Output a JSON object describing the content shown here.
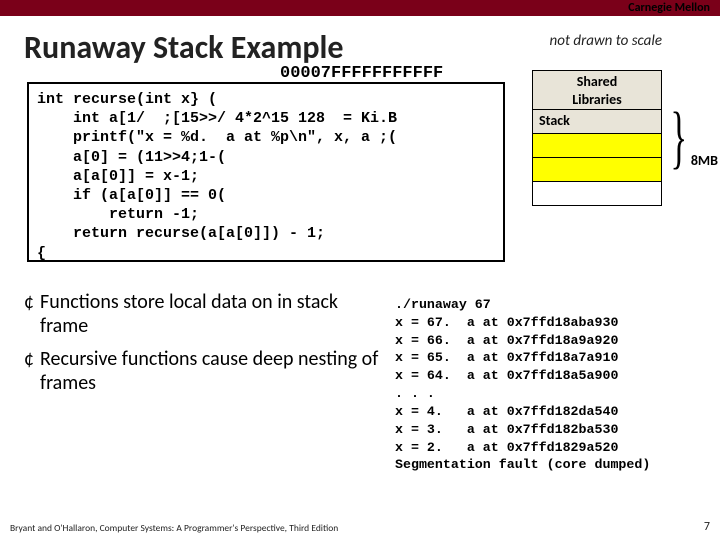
{
  "header": {
    "institution": "Carnegie Mellon"
  },
  "title": "Runaway Stack Example",
  "not_drawn": "not drawn to scale",
  "hexaddr": "00007FFFFFFFFFFF",
  "code": "int recurse(int x} (\n    int a[1/  ;[15>>/ 4*2^15 128  = Ki.B\n    printf(\"x = %d.  a at %p\\n\", x, a ;(\n    a[0] = (11>>4;1-(\n    a[a[0]] = x-1;\n    if (a[a[0]] == 0(\n        return -1;\n    return recurse(a[a[0]]) - 1;\n{",
  "mem": {
    "shared": "Shared\nLibraries",
    "stack": "Stack",
    "size_label": "8MB"
  },
  "bullets": [
    "Functions store local data on in stack frame",
    "Recursive functions cause deep nesting of frames"
  ],
  "runaway": "./runaway 67\nx = 67.  a at 0x7ffd18aba930\nx = 66.  a at 0x7ffd18a9a920\nx = 65.  a at 0x7ffd18a7a910\nx = 64.  a at 0x7ffd18a5a900\n. . .\nx = 4.   a at 0x7ffd182da540\nx = 3.   a at 0x7ffd182ba530\nx = 2.   a at 0x7ffd1829a520\nSegmentation fault (core dumped)",
  "footer": "Bryant and O'Hallaron, Computer Systems: A Programmer's Perspective, Third Edition",
  "pagenum": "7"
}
